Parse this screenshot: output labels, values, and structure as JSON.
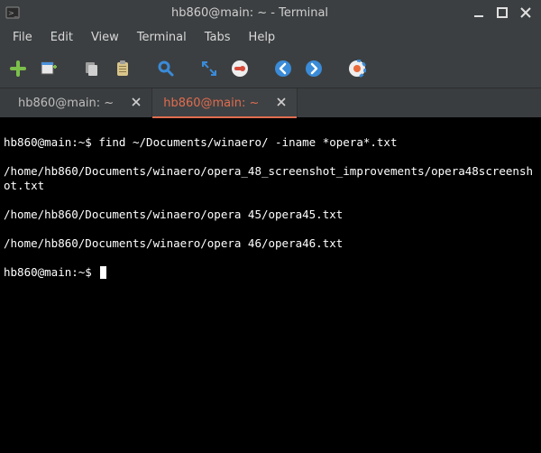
{
  "window": {
    "title": "hb860@main: ~ - Terminal"
  },
  "menubar": {
    "items": [
      "File",
      "Edit",
      "View",
      "Terminal",
      "Tabs",
      "Help"
    ]
  },
  "toolbar": {
    "new_tab": "new-tab",
    "new_window": "new-window",
    "copy": "copy",
    "paste": "paste",
    "search": "search",
    "fullscreen": "fullscreen",
    "preferences": "preferences",
    "back": "back",
    "forward": "forward",
    "help": "help"
  },
  "tabs": [
    {
      "label": "hb860@main: ~",
      "active": false
    },
    {
      "label": "hb860@main: ~",
      "active": true
    }
  ],
  "terminal": {
    "prompt1": "hb860@main:~$ ",
    "command1": "find ~/Documents/winaero/ -iname *opera*.txt",
    "output": [
      "/home/hb860/Documents/winaero/opera_48_screenshot_improvements/opera48screenshot.txt",
      "/home/hb860/Documents/winaero/opera 45/opera45.txt",
      "/home/hb860/Documents/winaero/opera 46/opera46.txt"
    ],
    "prompt2": "hb860@main:~$ "
  }
}
